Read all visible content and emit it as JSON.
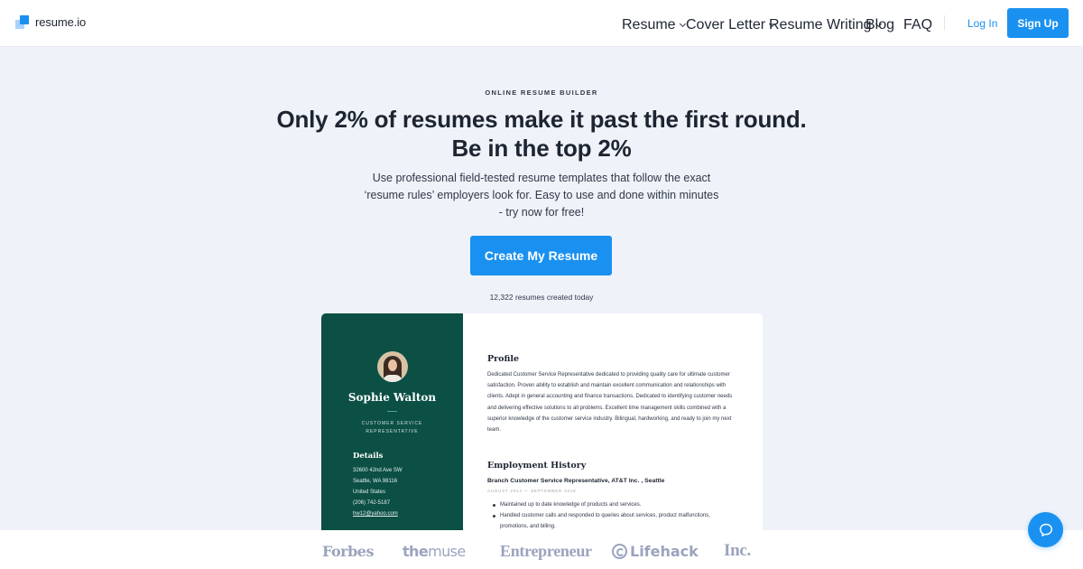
{
  "header": {
    "brand": "resume.io",
    "nav": [
      {
        "label": "Resume",
        "dropdown": true
      },
      {
        "label": "Cover Letter",
        "dropdown": true
      },
      {
        "label": "Resume Writing",
        "dropdown": true
      },
      {
        "label": "Blog",
        "dropdown": false
      },
      {
        "label": "FAQ",
        "dropdown": false
      }
    ],
    "login_label": "Log In",
    "signup_label": "Sign Up"
  },
  "hero": {
    "eyebrow": "ONLINE RESUME BUILDER",
    "headline": "Only 2% of resumes make it past the first round. Be in the top 2%",
    "subtext": "Use professional field-tested resume templates that follow the exact ‘resume rules’ employers look for. Easy to use and done within minutes - try now for free!",
    "cta_label": "Create My Resume",
    "counter": "12,322 resumes created today"
  },
  "resume_preview": {
    "name": "Sophie Walton",
    "title": "CUSTOMER SERVICE REPRESENTATIVE",
    "details_heading": "Details",
    "details": [
      "32600 42nd Ave SW",
      "Seattle, WA 98116",
      "United States",
      "(206) 742-5187"
    ],
    "email": "hw12@yahoo.com",
    "profile_heading": "Profile",
    "profile_text": "Dedicated Customer Service Representative dedicated to providing quality care for ultimate customer satisfaction. Proven ability to establish and maintain excellent communication and relationships with clients. Adept in general accounting and finance transactions. Dedicated to identifying customer needs and delivering effective solutions to all problems. Excellent time management skills combined with a superior knowledge of the customer service industry. Bilingual, hardworking, and ready to join my next team.",
    "employment_heading": "Employment History",
    "job_title": "Branch Customer Service Representative, AT&T Inc. , Seattle",
    "job_dates": "AUGUST 2014 — SEPTEMBER 2019",
    "bullets": [
      "Maintained up to date knowledge of products and services.",
      "Handled customer calls and responded to queries about services, product malfunctions, promotions, and billing."
    ]
  },
  "press": {
    "logos": [
      "Forbes",
      "themuse",
      "Entrepreneur",
      "Lifehack",
      "Inc."
    ],
    "muse_bold": "the",
    "muse_light": "muse"
  },
  "colors": {
    "primary": "#1a91f0",
    "resume_sidebar": "#0b4f45",
    "page_bg": "#eff2f9",
    "press_logo": "#9ba3bd"
  }
}
